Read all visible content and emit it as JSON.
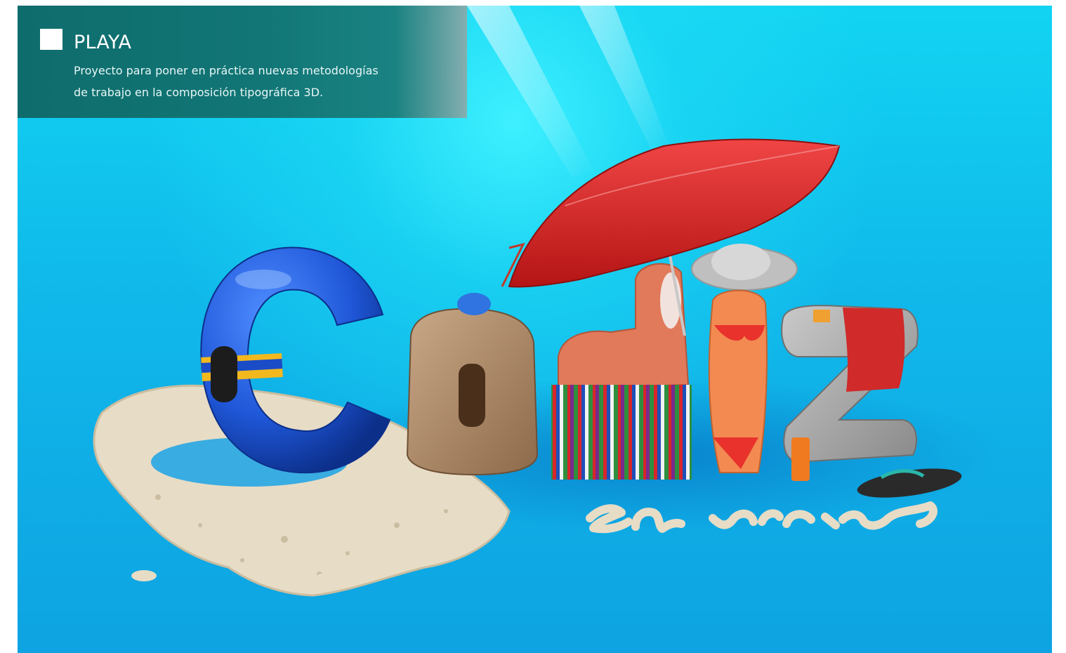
{
  "caption": {
    "title": "PLAYA",
    "description_lines": [
      "Proyecto para poner en práctica nuevas metodologías",
      "de trabajo en la composición tipográfica 3D."
    ]
  },
  "artwork": {
    "subject": "beach-typography-illustration",
    "colors": {
      "sky": "#12d4f2",
      "sea": "#0ea3e2",
      "sand": "#e7dcc6",
      "float_blue": "#1f57d8",
      "umbrella_red": "#d92626",
      "caption_panel": "#0f6c6c"
    }
  }
}
